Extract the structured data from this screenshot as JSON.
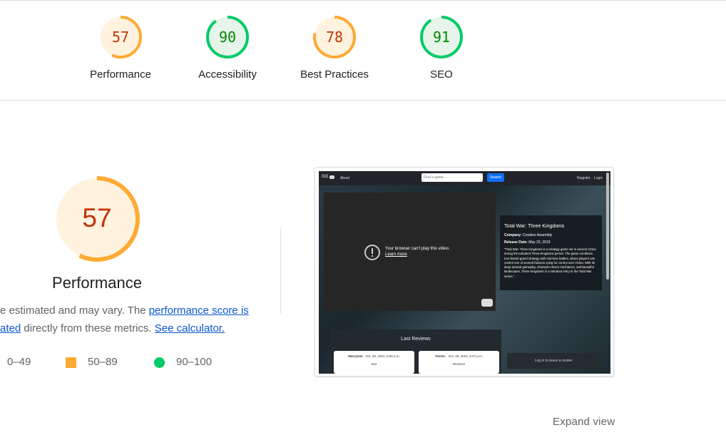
{
  "categories": [
    {
      "name": "Performance",
      "score": 57,
      "color": "#fa3",
      "text_color": "#c33300",
      "bg": "#fff3e0"
    },
    {
      "name": "Accessibility",
      "score": 90,
      "color": "#0c6",
      "text_color": "#008800",
      "bg": "#e6f4ea"
    },
    {
      "name": "Best Practices",
      "score": 78,
      "color": "#fa3",
      "text_color": "#c33300",
      "bg": "#fff3e0"
    },
    {
      "name": "SEO",
      "score": 91,
      "color": "#0c6",
      "text_color": "#008800",
      "bg": "#e6f4ea"
    }
  ],
  "performance": {
    "score": 57,
    "title": "Performance",
    "desc_start": "e estimated and may vary. The ",
    "link1": "performance score is",
    "link1b": "ated",
    "desc_mid": " directly from these metrics. ",
    "link2": "See calculator."
  },
  "legend": [
    {
      "label": "0–49",
      "shape": "triangle",
      "color": "#f33"
    },
    {
      "label": "50–89",
      "shape": "square",
      "color": "#fa3"
    },
    {
      "label": "90–100",
      "shape": "circle",
      "color": "#0c6"
    }
  ],
  "screenshot": {
    "nav_brand": "GG",
    "nav_about": "About",
    "search_placeholder": "Find a game...",
    "search_button": "Search",
    "register": "Register",
    "login": "Login",
    "video_message": "Your browser can't play this video.",
    "video_link": "Learn more",
    "game_title": "Total War: Three Kingdoms",
    "company_label": "Company:",
    "company": "Creative Assembly",
    "release_label": "Release Date:",
    "release": "May 23, 2019",
    "description": "\"Total War: Three Kingdoms is a strategy game set in ancient China during the turbulent Three Kingdoms period. The game combines turn-based grand strategy with real-time battles, where players can control one of several factions vying for control over China. With its deep tactical gameplay, character-driven mechanics, and beautiful landscapes, Three Kingdoms is a standout entry in the Total War series.\"",
    "reviews_title": "Last Reviews",
    "review1_author": "Marrytest",
    "review1_date": "· Oct. 30, 2024, 6:00 p.m.",
    "review1_text": "test",
    "review2_author": "TestAc",
    "review2_date": "· Oct. 28, 2024, 6:07 p.m.",
    "review2_text": "Reviews",
    "login_prompt": "Log in to leave a review"
  },
  "expand_view": "Expand view"
}
